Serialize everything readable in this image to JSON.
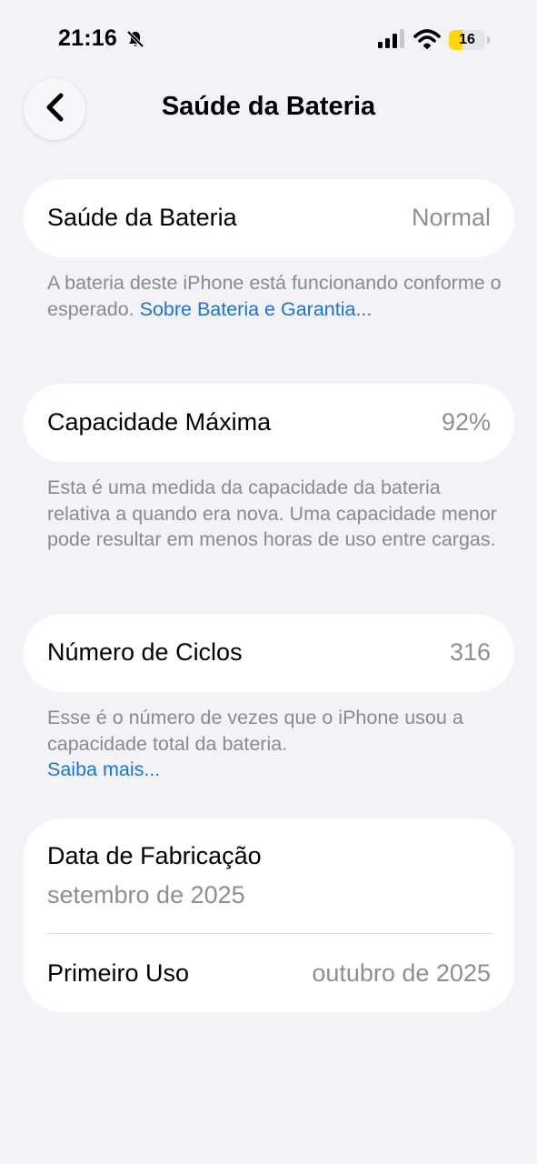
{
  "status_bar": {
    "time": "21:16",
    "battery_level": "16",
    "icons": [
      "bell-slash-icon",
      "cellular-signal-icon",
      "wifi-icon",
      "battery-icon"
    ],
    "battery_color": "#ffd60a"
  },
  "nav": {
    "title": "Saúde da Bateria",
    "back_icon": "chevron-left-icon"
  },
  "sections": {
    "battery_health": {
      "label": "Saúde da Bateria",
      "value": "Normal",
      "footnote": "A bateria deste iPhone está funcionando conforme o esperado. ",
      "link": "Sobre Bateria e Garantia..."
    },
    "max_capacity": {
      "label": "Capacidade Máxima",
      "value": "92%",
      "footnote": "Esta é uma medida da capacidade da bateria relativa a quando era nova. Uma capacidade menor pode resultar em menos horas de uso entre cargas."
    },
    "cycle_count": {
      "label": "Número de Ciclos",
      "value": "316",
      "footnote": "Esse é o número de vezes que o iPhone usou a capacidade total da bateria.",
      "link": "Saiba mais..."
    },
    "dates": {
      "manufacture_label": "Data de Fabricação",
      "manufacture_value": "setembro de 2025",
      "first_use_label": "Primeiro Uso",
      "first_use_value": "outubro de 2025"
    }
  },
  "colors": {
    "background": "#f2f2f7",
    "card": "#ffffff",
    "link": "#1a73d9",
    "secondary_text": "#8e8e93"
  }
}
